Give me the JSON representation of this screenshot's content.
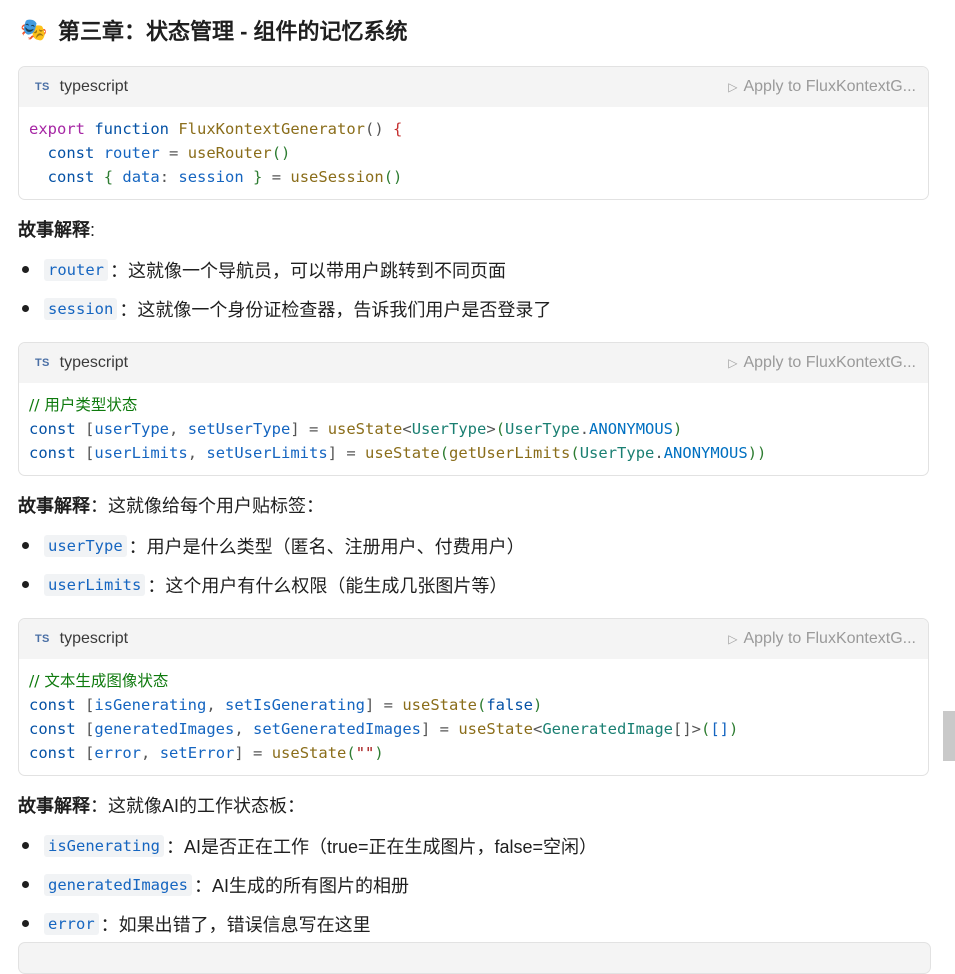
{
  "heading": {
    "emoji": "🎭",
    "title": "第三章：状态管理 - 组件的记忆系统"
  },
  "blocks": [
    {
      "lang_badge": "TS",
      "lang": "typescript",
      "apply": "Apply to FluxKontextG..."
    },
    {
      "lang_badge": "TS",
      "lang": "typescript",
      "apply": "Apply to FluxKontextG..."
    },
    {
      "lang_badge": "TS",
      "lang": "typescript",
      "apply": "Apply to FluxKontextG..."
    }
  ],
  "code1": {
    "l1": [
      "export",
      " ",
      "function",
      " ",
      "FluxKontextGenerator",
      "()",
      " ",
      "{"
    ],
    "l2": [
      "  ",
      "const",
      " ",
      "router",
      " = ",
      "useRouter",
      "()"
    ],
    "l3": [
      "  ",
      "const",
      " ",
      "{",
      " ",
      "data",
      ": ",
      "session",
      " ",
      "}",
      " = ",
      "useSession",
      "()"
    ]
  },
  "code2": {
    "comment": "// 用户类型状态",
    "l1": [
      "const",
      " ",
      "[",
      "userType",
      ", ",
      "setUserType",
      "]",
      " = ",
      "useState",
      "<",
      "UserType",
      ">",
      "(",
      "UserType",
      ".",
      "ANONYMOUS",
      ")"
    ],
    "l2": [
      "const",
      " ",
      "[",
      "userLimits",
      ", ",
      "setUserLimits",
      "]",
      " = ",
      "useState",
      "(",
      "getUserLimits",
      "(",
      "UserType",
      ".",
      "ANONYMOUS",
      "))"
    ]
  },
  "code3": {
    "comment": "// 文本生成图像状态",
    "l1": [
      "const",
      " ",
      "[",
      "isGenerating",
      ", ",
      "setIsGenerating",
      "]",
      " = ",
      "useState",
      "(",
      "false",
      ")"
    ],
    "l2": [
      "const",
      " ",
      "[",
      "generatedImages",
      ", ",
      "setGeneratedImages",
      "]",
      " = ",
      "useState",
      "<",
      "GeneratedImage",
      "[]>",
      "(",
      "[]",
      ")"
    ],
    "l3": [
      "const",
      " ",
      "[",
      "error",
      ", ",
      "setError",
      "]",
      " = ",
      "useState",
      "(",
      "\"\"",
      ")"
    ]
  },
  "story_label": "故事解释",
  "story1": {
    "tail": ":"
  },
  "bullets1": [
    {
      "code": "router",
      "text": "：这就像一个导航员，可以带用户跳转到不同页面"
    },
    {
      "code": "session",
      "text": "：这就像一个身份证检查器，告诉我们用户是否登录了"
    }
  ],
  "story2": {
    "tail": "：这就像给每个用户贴标签："
  },
  "bullets2": [
    {
      "code": "userType",
      "text": "：用户是什么类型（匿名、注册用户、付费用户）"
    },
    {
      "code": "userLimits",
      "text": "：这个用户有什么权限（能生成几张图片等）"
    }
  ],
  "story3": {
    "tail": "：这就像AI的工作状态板："
  },
  "bullets3": [
    {
      "code": "isGenerating",
      "text": "：AI是否正在工作（true=正在生成图片，false=空闲）"
    },
    {
      "code": "generatedImages",
      "text": "：AI生成的所有图片的相册"
    },
    {
      "code": "error",
      "text": "：如果出错了，错误信息写在这里"
    }
  ]
}
